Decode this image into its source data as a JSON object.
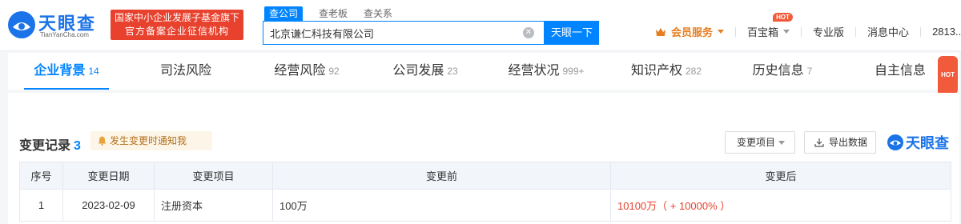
{
  "logo": {
    "cn": "天眼查",
    "en": "TianYanCha.com"
  },
  "gov_badge": {
    "line1": "国家中小企业发展子基金旗下",
    "line2": "官方备案企业征信机构"
  },
  "search": {
    "tabs": [
      "查公司",
      "查老板",
      "查关系"
    ],
    "value": "北京谦仁科技有限公司",
    "button": "天眼一下"
  },
  "nav": {
    "vip": "会员服务",
    "toolbox": "百宝箱",
    "hot": "HOT",
    "pro": "专业版",
    "messages": "消息中心",
    "user": "2813..."
  },
  "tabs": [
    {
      "label": "企业背景",
      "count": "14"
    },
    {
      "label": "司法风险",
      "count": ""
    },
    {
      "label": "经营风险",
      "count": "92"
    },
    {
      "label": "公司发展",
      "count": "23"
    },
    {
      "label": "经营状况",
      "count": "999+"
    },
    {
      "label": "知识产权",
      "count": "282"
    },
    {
      "label": "历史信息",
      "count": "7"
    },
    {
      "label": "自主信息",
      "count": "",
      "hot": "HOT"
    }
  ],
  "section": {
    "title": "变更记录",
    "count": "3",
    "notify": "发生变更时通知我",
    "filter": "变更项目",
    "export": "导出数据",
    "brand": "天眼查"
  },
  "table": {
    "headers": [
      "序号",
      "变更日期",
      "变更项目",
      "变更前",
      "变更后"
    ],
    "rows": [
      {
        "no": "1",
        "date": "2023-02-09",
        "item": "注册资本",
        "before": "100万",
        "after": "10100万（ + 10000% ）"
      }
    ]
  },
  "colors": {
    "accent": "#0084ff",
    "red": "#e8412e",
    "vip": "#e67e22"
  }
}
